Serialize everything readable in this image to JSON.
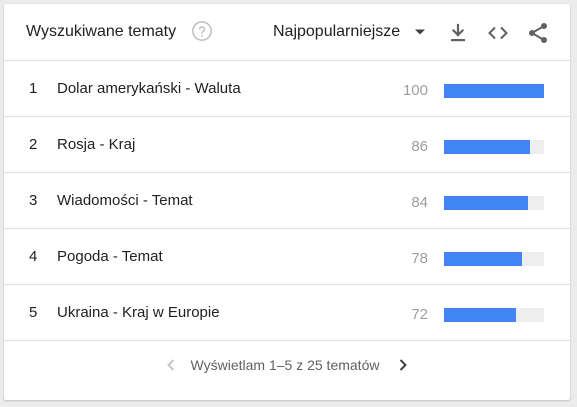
{
  "header": {
    "title": "Wyszukiwane tematy",
    "help_icon": "help-circle-icon",
    "sort_value": "Najpopularniejsze",
    "icons": [
      "download-icon",
      "embed-code-icon",
      "share-icon"
    ]
  },
  "colors": {
    "bar": "#4285f4",
    "track": "#eeeeee",
    "score_text": "#9e9e9e"
  },
  "rows": [
    {
      "rank": "1",
      "topic": "Dolar amerykański - Waluta",
      "score": "100",
      "value": 100
    },
    {
      "rank": "2",
      "topic": "Rosja - Kraj",
      "score": "86",
      "value": 86
    },
    {
      "rank": "3",
      "topic": "Wiadomości - Temat",
      "score": "84",
      "value": 84
    },
    {
      "rank": "4",
      "topic": "Pogoda - Temat",
      "score": "78",
      "value": 78
    },
    {
      "rank": "5",
      "topic": "Ukraina - Kraj w Europie",
      "score": "72",
      "value": 72
    }
  ],
  "pagination": {
    "text": "Wyświetlam 1–5 z 25 tematów"
  }
}
